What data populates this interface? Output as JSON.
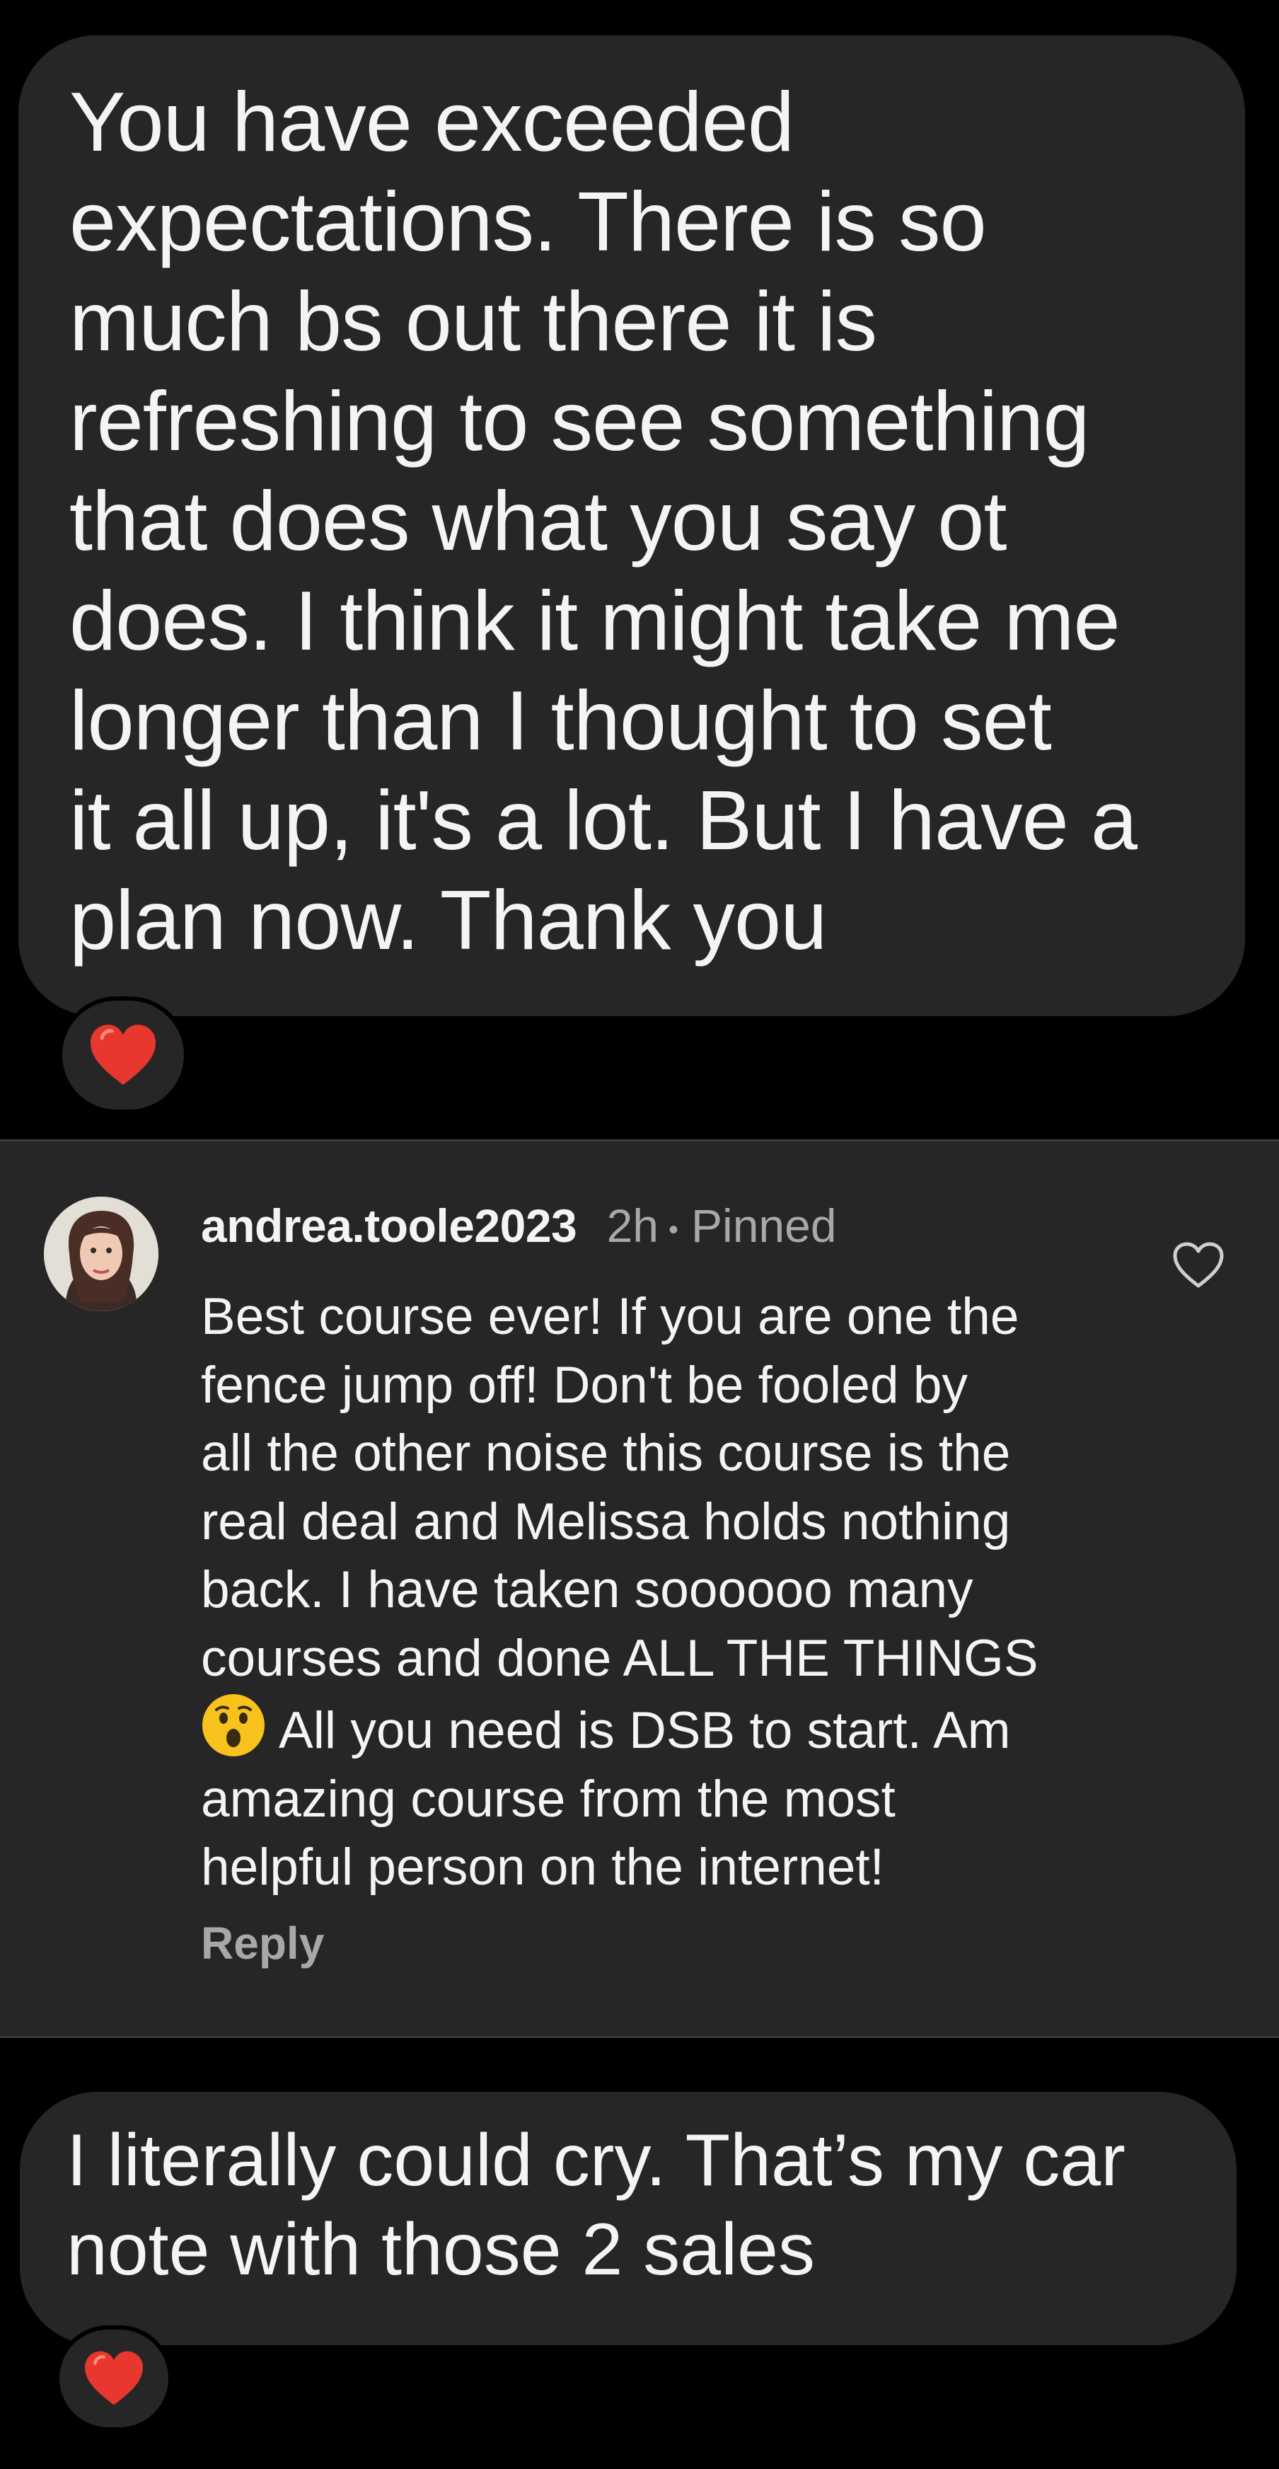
{
  "message_top": {
    "text": "You have exceeded\nexpectations. There is so\nmuch bs out there it is\nrefreshing to see something\nthat does what you say ot\ndoes. I think it might take me\nlonger than I thought to set\nit all up, it's a lot. But I have a\nplan now. Thank you",
    "reaction": "heart-emoji"
  },
  "comment": {
    "username": "andrea.toole2023",
    "time": "2h",
    "separator": "•",
    "status": "Pinned",
    "body_before_emoji": "Best course ever! If you are one the\nfence jump off! Don't be fooled by\nall the other noise this course is the\nreal deal and Melissa holds nothing\nback. I have taken soooooo many\ncourses and done ALL THE THINGS\n",
    "emoji": "astonished-face-emoji",
    "body_after_emoji": "All you need is DSB to start. Am\namazing course from the most\nhelpful person on the internet!",
    "reply_label": "Reply",
    "like_icon": "heart-outline-icon"
  },
  "message_bottom": {
    "text": "I literally could cry. That’s my car\nnote with those 2 sales",
    "reaction": "heart-emoji"
  },
  "colors": {
    "background": "#000000",
    "bubble": "#262626",
    "text": "#f4f4f4",
    "muted": "#a8a8a8",
    "heart": "#e8372e"
  }
}
